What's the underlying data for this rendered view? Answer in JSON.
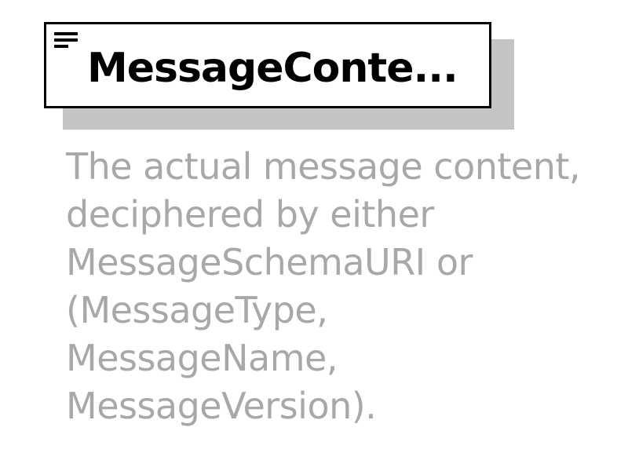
{
  "element": {
    "name": "MessageConte...",
    "icon": "sequence-content-icon"
  },
  "annotation": {
    "lines": [
      "The actual message content,",
      "deciphered by either",
      "MessageSchemaURI or",
      "(MessageType,",
      "MessageName,",
      "MessageVersion)."
    ]
  },
  "colors": {
    "border": "#000000",
    "shadow": "#c4c4c4",
    "annotation_text": "#a8a8a8"
  }
}
